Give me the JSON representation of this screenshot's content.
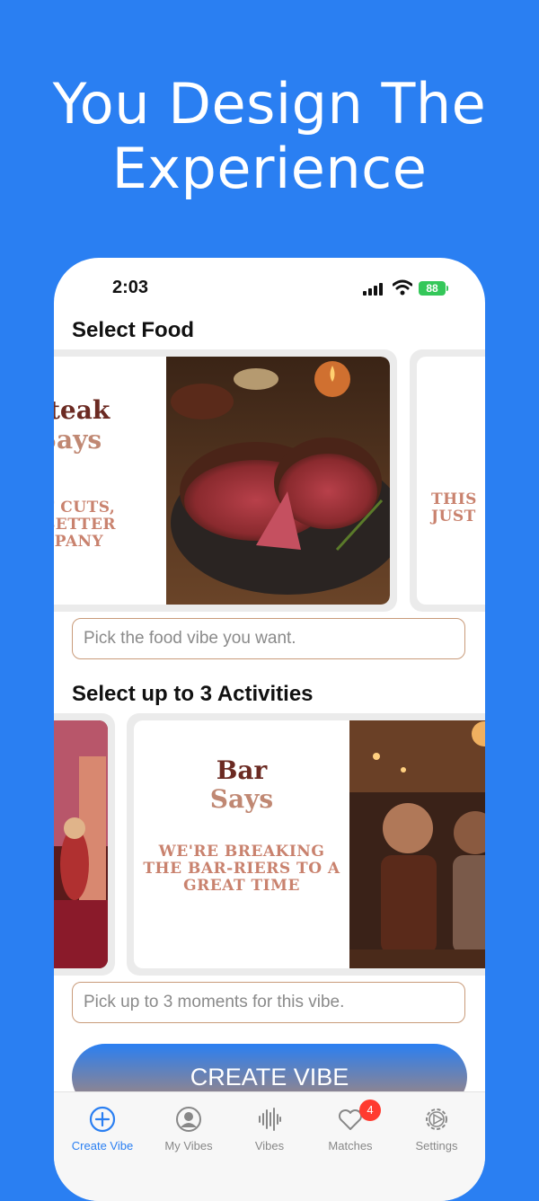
{
  "headline": {
    "line1": "You Design The",
    "line2": "Experience"
  },
  "status": {
    "time": "2:03",
    "battery": "88"
  },
  "food": {
    "section_title": "Select Food",
    "card_left": {
      "title": "Steak",
      "sub": "Says",
      "tag1": "T CUTS,",
      "tag2": "BETTER",
      "tag3": "PANY"
    },
    "card_right": {
      "tag1": "THIS",
      "tag2": "JUST"
    },
    "input_placeholder": "Pick the food vibe you want."
  },
  "activities": {
    "section_title": "Select up to 3 Activities",
    "card_main": {
      "title": "Bar",
      "sub": "Says",
      "tag1": "WE'RE BREAKING",
      "tag2": "THE BAR-RIERS TO A",
      "tag3": "GREAT TIME"
    },
    "input_placeholder": "Pick up to 3 moments for this vibe."
  },
  "create_button": "CREATE VIBE",
  "tabs": [
    {
      "label": "Create Vibe",
      "icon": "plus-circle-icon"
    },
    {
      "label": "My Vibes",
      "icon": "person-circle-icon"
    },
    {
      "label": "Vibes",
      "icon": "waveform-icon"
    },
    {
      "label": "Matches",
      "icon": "heart-icon",
      "badge": "4"
    },
    {
      "label": "Settings",
      "icon": "gear-icon"
    }
  ],
  "colors": {
    "background": "#2a7ff2",
    "accent": "#2a7ff2",
    "brown": "#6b2a22",
    "tan": "#c08873"
  }
}
